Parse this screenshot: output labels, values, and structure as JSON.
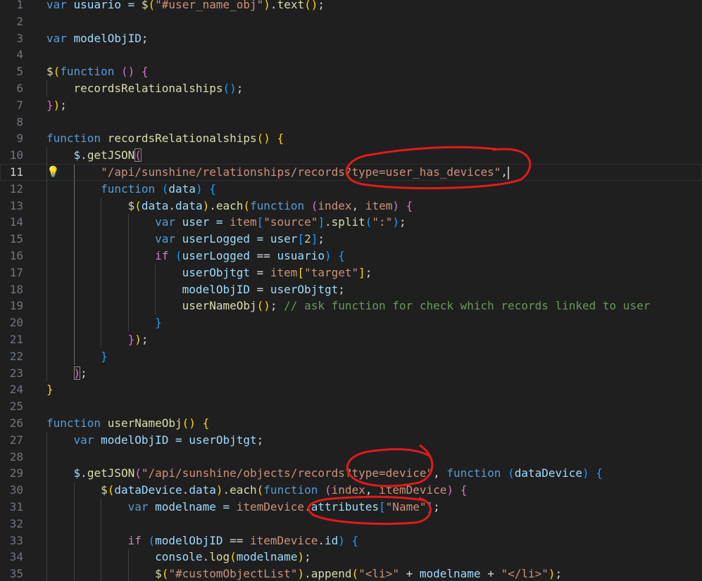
{
  "editor": {
    "lines": [
      {
        "n": "1",
        "tokens": [
          [
            "var",
            "k"
          ],
          [
            " usuario = ",
            "v"
          ],
          [
            "$",
            "f"
          ],
          [
            "(",
            "b1"
          ],
          [
            "\"#user_name_obj\"",
            "s"
          ],
          [
            ")",
            "b1"
          ],
          [
            ".",
            "pn"
          ],
          [
            "text",
            "f"
          ],
          [
            "()",
            "b1"
          ],
          [
            ";",
            "pn"
          ]
        ]
      },
      {
        "n": "2",
        "tokens": []
      },
      {
        "n": "3",
        "tokens": [
          [
            "var",
            "k"
          ],
          [
            " modelObjID",
            "v"
          ],
          [
            ";",
            "pn"
          ]
        ]
      },
      {
        "n": "4",
        "tokens": []
      },
      {
        "n": "5",
        "tokens": [
          [
            "$",
            "f"
          ],
          [
            "(",
            "b1"
          ],
          [
            "function",
            "k"
          ],
          [
            " ",
            "pn"
          ],
          [
            "()",
            "b2"
          ],
          [
            " ",
            "pn"
          ],
          [
            "{",
            "b2"
          ]
        ]
      },
      {
        "n": "6",
        "tokens": [
          [
            "    ",
            "pn"
          ],
          [
            "recordsRelationalships",
            "f"
          ],
          [
            "()",
            "b3"
          ],
          [
            ";",
            "pn"
          ]
        ]
      },
      {
        "n": "7",
        "tokens": [
          [
            "}",
            "b2"
          ],
          [
            ")",
            "b1"
          ],
          [
            ";",
            "pn"
          ]
        ]
      },
      {
        "n": "8",
        "tokens": []
      },
      {
        "n": "9",
        "tokens": [
          [
            "function",
            "k"
          ],
          [
            " ",
            "pn"
          ],
          [
            "recordsRelationalships",
            "f"
          ],
          [
            "()",
            "b1"
          ],
          [
            " ",
            "pn"
          ],
          [
            "{",
            "b1"
          ]
        ]
      },
      {
        "n": "10",
        "tokens": [
          [
            "    ",
            "pn"
          ],
          [
            "$",
            "v"
          ],
          [
            ".",
            "pn"
          ],
          [
            "getJSON",
            "f"
          ],
          [
            "(",
            "b2",
            "bm"
          ]
        ]
      },
      {
        "n": "11",
        "active": true,
        "bulb": true,
        "cursor": true,
        "tokens": [
          [
            "        ",
            "pn"
          ],
          [
            "\"/api/sunshine/relationships/records?type=user_has_devices\"",
            "s"
          ],
          [
            ",",
            "pn"
          ]
        ]
      },
      {
        "n": "12",
        "tokens": [
          [
            "        ",
            "pn"
          ],
          [
            "function",
            "k"
          ],
          [
            " ",
            "pn"
          ],
          [
            "(",
            "b3"
          ],
          [
            "data",
            "v"
          ],
          [
            ")",
            "b3"
          ],
          [
            " ",
            "pn"
          ],
          [
            "{",
            "b3"
          ]
        ]
      },
      {
        "n": "13",
        "tokens": [
          [
            "            ",
            "pn"
          ],
          [
            "$",
            "f"
          ],
          [
            "(",
            "b1"
          ],
          [
            "data",
            "v"
          ],
          [
            ".",
            "pn"
          ],
          [
            "data",
            "v"
          ],
          [
            ")",
            "b1"
          ],
          [
            ".",
            "pn"
          ],
          [
            "each",
            "f"
          ],
          [
            "(",
            "b1"
          ],
          [
            "function",
            "k"
          ],
          [
            " ",
            "pn"
          ],
          [
            "(",
            "b2"
          ],
          [
            "index",
            "s"
          ],
          [
            ", ",
            "pn"
          ],
          [
            "item",
            "s"
          ],
          [
            ")",
            "b2"
          ],
          [
            " ",
            "pn"
          ],
          [
            "{",
            "b2"
          ]
        ]
      },
      {
        "n": "14",
        "tokens": [
          [
            "                ",
            "pn"
          ],
          [
            "var",
            "k"
          ],
          [
            " user = ",
            "v"
          ],
          [
            "item",
            "s"
          ],
          [
            "[",
            "b3"
          ],
          [
            "\"source\"",
            "s"
          ],
          [
            "]",
            "b3"
          ],
          [
            ".",
            "pn"
          ],
          [
            "split",
            "f"
          ],
          [
            "(",
            "b3"
          ],
          [
            "\":\"",
            "s"
          ],
          [
            ")",
            "b3"
          ],
          [
            ";",
            "pn"
          ]
        ]
      },
      {
        "n": "15",
        "tokens": [
          [
            "                ",
            "pn"
          ],
          [
            "var",
            "k"
          ],
          [
            " userLogged = user",
            "v"
          ],
          [
            "[",
            "b3"
          ],
          [
            "2",
            "n"
          ],
          [
            "]",
            "b3"
          ],
          [
            ";",
            "pn"
          ]
        ]
      },
      {
        "n": "16",
        "tokens": [
          [
            "                ",
            "pn"
          ],
          [
            "if",
            "c"
          ],
          [
            " ",
            "pn"
          ],
          [
            "(",
            "b3"
          ],
          [
            "userLogged",
            "v"
          ],
          [
            " == ",
            "pn"
          ],
          [
            "usuario",
            "v"
          ],
          [
            ")",
            "b3"
          ],
          [
            " ",
            "pn"
          ],
          [
            "{",
            "b3"
          ]
        ]
      },
      {
        "n": "17",
        "tokens": [
          [
            "                    ",
            "pn"
          ],
          [
            "userObjtgt",
            "v"
          ],
          [
            " = ",
            "pn"
          ],
          [
            "item",
            "s"
          ],
          [
            "[",
            "b1"
          ],
          [
            "\"target\"",
            "s"
          ],
          [
            "]",
            "b1"
          ],
          [
            ";",
            "pn"
          ]
        ]
      },
      {
        "n": "18",
        "tokens": [
          [
            "                    ",
            "pn"
          ],
          [
            "modelObjID",
            "v"
          ],
          [
            " = ",
            "pn"
          ],
          [
            "userObjtgt",
            "v"
          ],
          [
            ";",
            "pn"
          ]
        ]
      },
      {
        "n": "19",
        "tokens": [
          [
            "                    ",
            "pn"
          ],
          [
            "userNameObj",
            "f"
          ],
          [
            "()",
            "b1"
          ],
          [
            ";",
            "pn"
          ],
          [
            " // ask function for check which records linked to user",
            "m"
          ]
        ]
      },
      {
        "n": "20",
        "tokens": [
          [
            "                ",
            "pn"
          ],
          [
            "}",
            "b3"
          ]
        ]
      },
      {
        "n": "21",
        "tokens": [
          [
            "            ",
            "pn"
          ],
          [
            "}",
            "b2"
          ],
          [
            ")",
            "b1"
          ],
          [
            ";",
            "pn"
          ]
        ]
      },
      {
        "n": "22",
        "tokens": [
          [
            "        ",
            "pn"
          ],
          [
            "}",
            "b3"
          ]
        ]
      },
      {
        "n": "23",
        "tokens": [
          [
            "    ",
            "pn"
          ],
          [
            ")",
            "b2",
            "bm"
          ],
          [
            ";",
            "pn"
          ]
        ]
      },
      {
        "n": "24",
        "tokens": [
          [
            "}",
            "b1"
          ]
        ]
      },
      {
        "n": "25",
        "tokens": []
      },
      {
        "n": "26",
        "tokens": [
          [
            "function",
            "k"
          ],
          [
            " ",
            "pn"
          ],
          [
            "userNameObj",
            "f"
          ],
          [
            "()",
            "b1"
          ],
          [
            " ",
            "pn"
          ],
          [
            "{",
            "b1"
          ]
        ]
      },
      {
        "n": "27",
        "tokens": [
          [
            "    ",
            "pn"
          ],
          [
            "var",
            "k"
          ],
          [
            " modelObjID = userObjtgt",
            "v"
          ],
          [
            ";",
            "pn"
          ]
        ]
      },
      {
        "n": "28",
        "tokens": []
      },
      {
        "n": "29",
        "tokens": [
          [
            "    ",
            "pn"
          ],
          [
            "$",
            "v"
          ],
          [
            ".",
            "pn"
          ],
          [
            "getJSON",
            "f"
          ],
          [
            "(",
            "b2"
          ],
          [
            "\"/api/sunshine/objects/records?type=device\"",
            "s"
          ],
          [
            ", ",
            "pn"
          ],
          [
            "function",
            "k"
          ],
          [
            " ",
            "pn"
          ],
          [
            "(",
            "b3"
          ],
          [
            "dataDevice",
            "v"
          ],
          [
            ")",
            "b3"
          ],
          [
            " ",
            "pn"
          ],
          [
            "{",
            "b3"
          ]
        ]
      },
      {
        "n": "30",
        "tokens": [
          [
            "        ",
            "pn"
          ],
          [
            "$",
            "f"
          ],
          [
            "(",
            "b1"
          ],
          [
            "dataDevice",
            "v"
          ],
          [
            ".",
            "pn"
          ],
          [
            "data",
            "v"
          ],
          [
            ")",
            "b1"
          ],
          [
            ".",
            "pn"
          ],
          [
            "each",
            "f"
          ],
          [
            "(",
            "b1"
          ],
          [
            "function",
            "k"
          ],
          [
            " ",
            "pn"
          ],
          [
            "(",
            "b2"
          ],
          [
            "index",
            "s"
          ],
          [
            ", ",
            "pn"
          ],
          [
            "itemDevice",
            "s"
          ],
          [
            ")",
            "b2"
          ],
          [
            " ",
            "pn"
          ],
          [
            "{",
            "b2"
          ]
        ]
      },
      {
        "n": "31",
        "tokens": [
          [
            "            ",
            "pn"
          ],
          [
            "var",
            "k"
          ],
          [
            " modelname = ",
            "v"
          ],
          [
            "itemDevice",
            "s"
          ],
          [
            ".",
            "pn"
          ],
          [
            "attributes",
            "v"
          ],
          [
            "[",
            "b3"
          ],
          [
            "\"Name\"",
            "s"
          ],
          [
            "]",
            "b3"
          ],
          [
            ";",
            "pn"
          ]
        ]
      },
      {
        "n": "32",
        "tokens": []
      },
      {
        "n": "33",
        "tokens": [
          [
            "            ",
            "pn"
          ],
          [
            "if",
            "c"
          ],
          [
            " ",
            "pn"
          ],
          [
            "(",
            "b3"
          ],
          [
            "modelObjID",
            "v"
          ],
          [
            " == ",
            "pn"
          ],
          [
            "itemDevice",
            "s"
          ],
          [
            ".",
            "pn"
          ],
          [
            "id",
            "v"
          ],
          [
            ")",
            "b3"
          ],
          [
            " ",
            "pn"
          ],
          [
            "{",
            "b3"
          ]
        ]
      },
      {
        "n": "34",
        "tokens": [
          [
            "                ",
            "pn"
          ],
          [
            "console",
            "v"
          ],
          [
            ".",
            "pn"
          ],
          [
            "log",
            "f"
          ],
          [
            "(",
            "b1"
          ],
          [
            "modelname",
            "v"
          ],
          [
            ")",
            "b1"
          ],
          [
            ";",
            "pn"
          ]
        ]
      },
      {
        "n": "35",
        "tokens": [
          [
            "                ",
            "pn"
          ],
          [
            "$",
            "f"
          ],
          [
            "(",
            "b1"
          ],
          [
            "\"#customObjectList\"",
            "s"
          ],
          [
            ")",
            "b1"
          ],
          [
            ".",
            "pn"
          ],
          [
            "append",
            "f"
          ],
          [
            "(",
            "b1"
          ],
          [
            "\"<li>\"",
            "s"
          ],
          [
            " + ",
            "pn"
          ],
          [
            "modelname",
            "v"
          ],
          [
            " + ",
            "pn"
          ],
          [
            "\"</li>\"",
            "s"
          ],
          [
            ")",
            "b1"
          ],
          [
            ";",
            "pn"
          ]
        ]
      }
    ]
  }
}
